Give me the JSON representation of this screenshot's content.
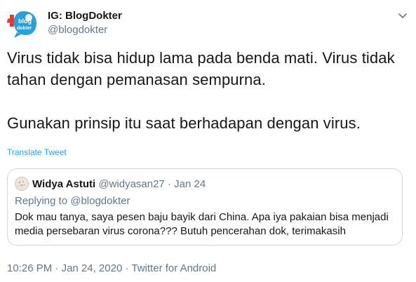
{
  "author": {
    "display_name": "IG: BlogDokter",
    "handle": "@blogdokter",
    "avatar_icon": "blogdokter-logo-icon",
    "brand_colors": {
      "red": "#e53935",
      "blue": "#2a9fd8"
    }
  },
  "tweet": {
    "paragraphs": [
      "Virus tidak bisa hidup lama pada benda mati. Virus tidak tahan dengan pemanasan sempurna.",
      "Gunakan prinsip itu saat berhadapan dengan virus."
    ],
    "translate_label": "Translate Tweet"
  },
  "quote": {
    "name": "Widya Astuti",
    "handle": "@widyasan27",
    "separator": "·",
    "date": "Jan 24",
    "replying_to": "Replying to @blogdokter",
    "text": "Dok mau tanya, saya pesen baju bayik dari China. Apa iya pakaian bisa menjadi media persebaran virus corona??? Butuh pencerahan dok, terimakasih"
  },
  "footer": {
    "time": "10:26 PM",
    "separator": "·",
    "date": "Jan 24, 2020",
    "source": "Twitter for Android"
  },
  "colors": {
    "text": "#14171a",
    "secondary": "#657786",
    "link": "#1da1f2",
    "border": "#ccd6dd"
  }
}
